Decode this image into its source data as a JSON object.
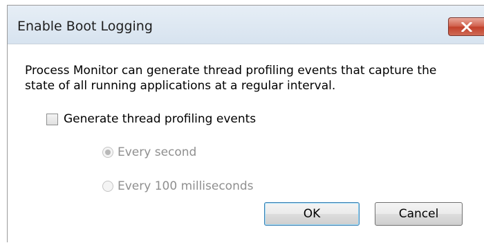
{
  "window": {
    "title": "Enable Boot Logging",
    "close_icon": "close-x-icon"
  },
  "content": {
    "description": "Process Monitor can generate thread profiling events that capture the state of all running applications at a regular interval.",
    "checkbox": {
      "label": "Generate thread profiling events",
      "checked": false
    },
    "radios": [
      {
        "label": "Every second",
        "selected": true,
        "enabled": false
      },
      {
        "label": "Every 100 milliseconds",
        "selected": false,
        "enabled": false
      }
    ]
  },
  "buttons": {
    "ok_label": "OK",
    "cancel_label": "Cancel"
  },
  "colors": {
    "close_button": "#c2402b",
    "default_button_border": "#3c7fb1",
    "disabled_text": "#8f8f8f"
  }
}
